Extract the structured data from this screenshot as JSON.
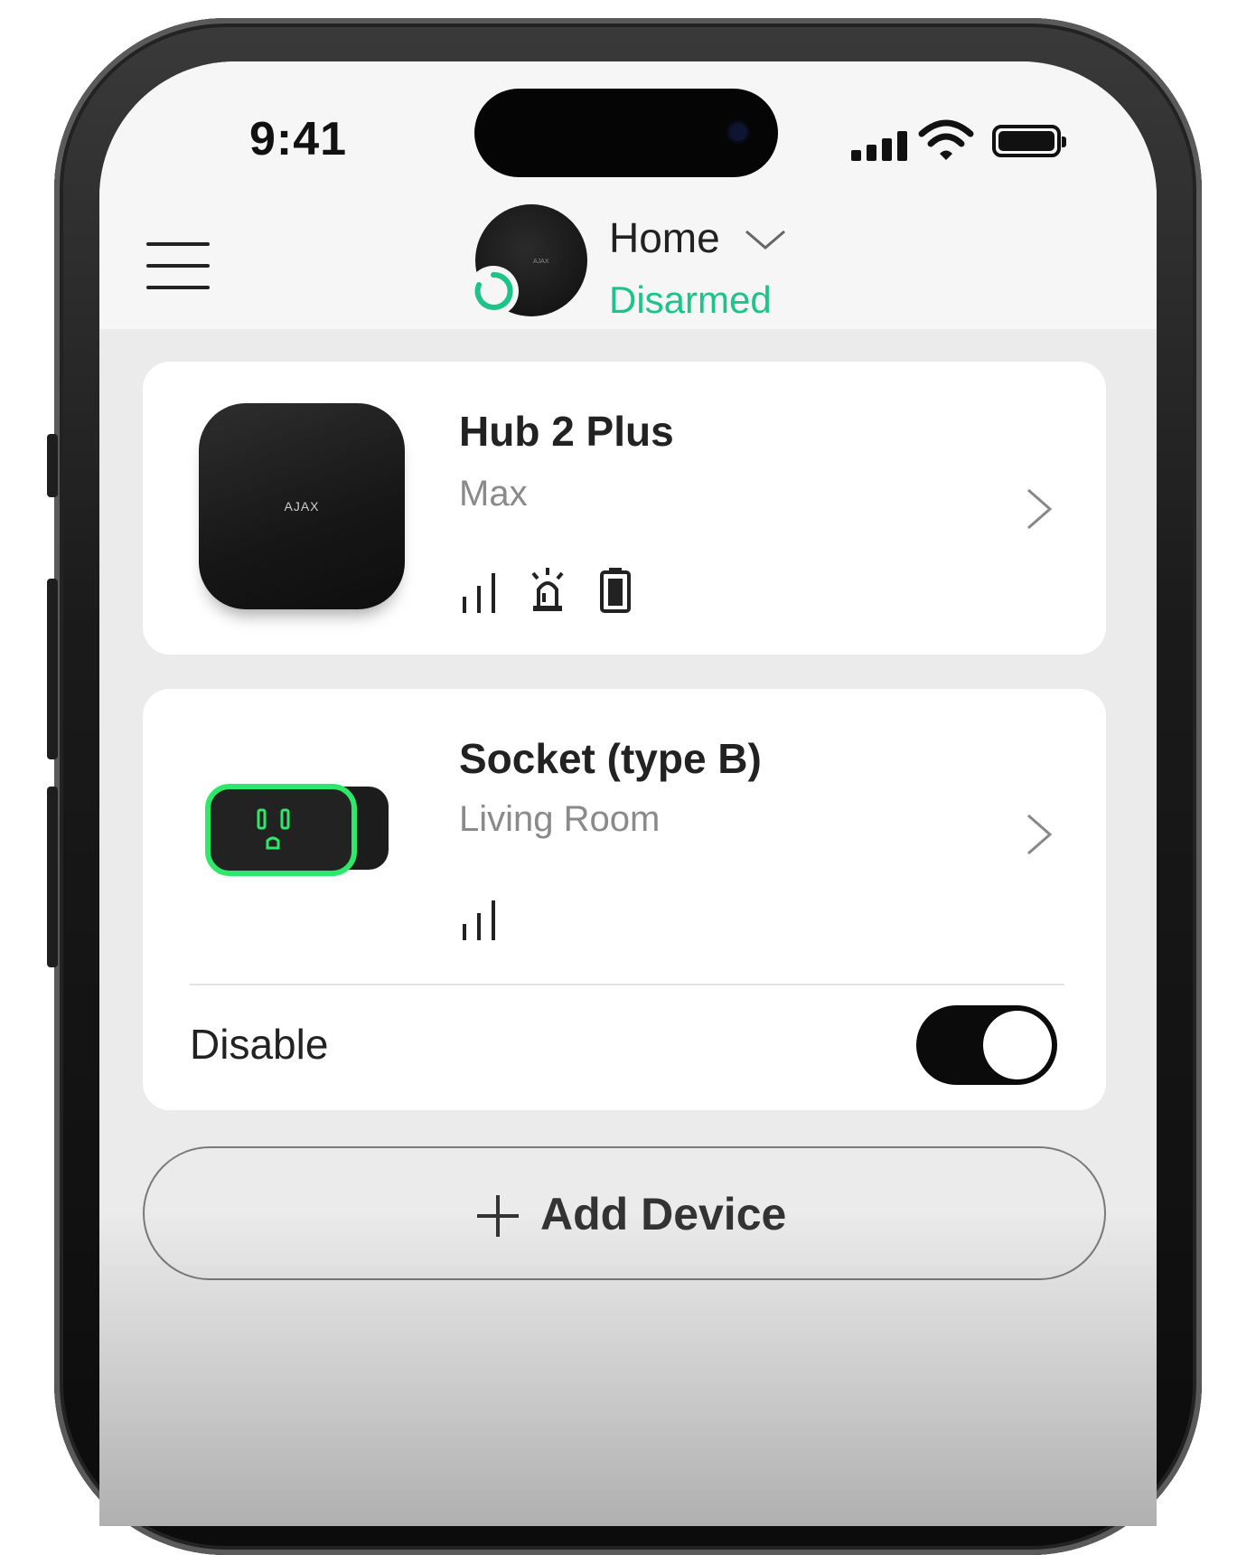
{
  "status_bar": {
    "time": "9:41"
  },
  "header": {
    "hub_name": "Home",
    "security_state": "Disarmed"
  },
  "devices": [
    {
      "name": "Hub 2 Plus",
      "room": "Max",
      "image_label": "AJAX",
      "icons": [
        "signal-icon",
        "siren-icon",
        "battery-icon"
      ]
    },
    {
      "name": "Socket (type B)",
      "room": "Living Room",
      "icons": [
        "signal-icon"
      ]
    }
  ],
  "socket_controls": {
    "disable_label": "Disable",
    "disable_on": true
  },
  "add_device": {
    "label": "Add Device"
  },
  "colors": {
    "accent_green": "#1ec38a",
    "toggle_on": "#0b0b0b"
  }
}
